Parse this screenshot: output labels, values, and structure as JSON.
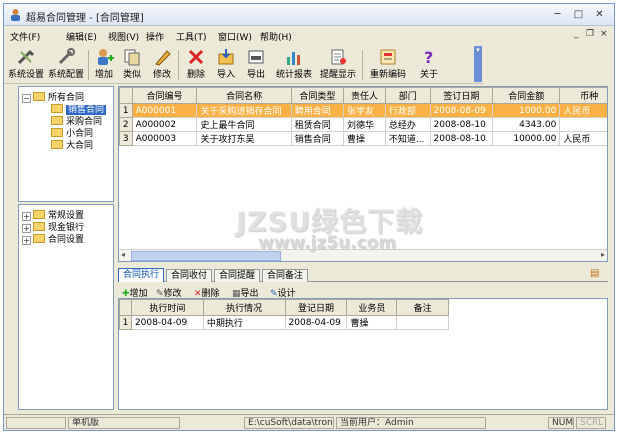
{
  "window": {
    "title": "超易合同管理 - [合同管理]",
    "accent": "#316ac5"
  },
  "menu": {
    "items": [
      "文件(F)",
      "编辑(E)",
      "视图(V)",
      "操作",
      "工具(T)",
      "窗口(W)",
      "帮助(H)"
    ]
  },
  "toolbar": {
    "buttons": [
      {
        "label": "系统设置",
        "icon": "tools-icon"
      },
      {
        "label": "系统配置",
        "icon": "config-icon"
      },
      {
        "label": "增加",
        "icon": "add-icon"
      },
      {
        "label": "类似",
        "icon": "copy-icon"
      },
      {
        "label": "修改",
        "icon": "pencil-icon"
      },
      {
        "label": "删除",
        "icon": "delete-icon"
      },
      {
        "label": "导入",
        "icon": "import-icon"
      },
      {
        "label": "导出",
        "icon": "export-icon"
      },
      {
        "label": "统计报表",
        "icon": "chart-icon"
      },
      {
        "label": "提醒显示",
        "icon": "reminder-icon"
      },
      {
        "label": "重新编码",
        "icon": "recode-icon"
      },
      {
        "label": "关于",
        "icon": "help-icon"
      }
    ]
  },
  "tree_top": {
    "root": "所有合同",
    "children": [
      "销售合同",
      "采购合同",
      "小合同",
      "大合同"
    ],
    "selected": "销售合同"
  },
  "tree_bottom": {
    "items": [
      "常规设置",
      "现金银行",
      "合同设置"
    ]
  },
  "contracts": {
    "headers": [
      "合同编号",
      "合同名称",
      "合同类型",
      "责任人",
      "部门",
      "签订日期",
      "合同金额",
      "币种"
    ],
    "rows": [
      {
        "n": "1",
        "cells": [
          "A000001",
          "关于采购进销存合同",
          "聘用合同",
          "张学友",
          "行政部",
          "2008-08-09",
          "1000.00",
          "人民币"
        ]
      },
      {
        "n": "2",
        "cells": [
          "A000002",
          "史上最牛合同",
          "租赁合同",
          "刘德华",
          "总经办",
          "2008-08-10",
          "4343.00",
          ""
        ]
      },
      {
        "n": "3",
        "cells": [
          "A000003",
          "关于攻打东吴",
          "销售合同",
          "曹操",
          "不知道...",
          "2008-08-10",
          "10000.00",
          "人民币"
        ]
      }
    ]
  },
  "detail_tabs": [
    "合同执行",
    "合同收付",
    "合同提醒",
    "合同备注"
  ],
  "detail_toolbar": [
    "增加",
    "修改",
    "删除",
    "导出",
    "设计"
  ],
  "execution": {
    "headers": [
      "执行时间",
      "执行情况",
      "登记日期",
      "业务员",
      "备注"
    ],
    "rows": [
      {
        "n": "1",
        "cells": [
          "2008-04-09",
          "中期执行",
          "2008-04-09",
          "曹操",
          ""
        ]
      }
    ]
  },
  "statusbar": {
    "mode": "单机版",
    "path": "E:\\cuSoft\\data\\troncuine.mc",
    "user": "当前用户：Admin",
    "num": "NUM",
    "scrl": "SCRL"
  },
  "watermark": {
    "line1": "JZSU绿色下载",
    "line2": "www.jz5u.com"
  }
}
